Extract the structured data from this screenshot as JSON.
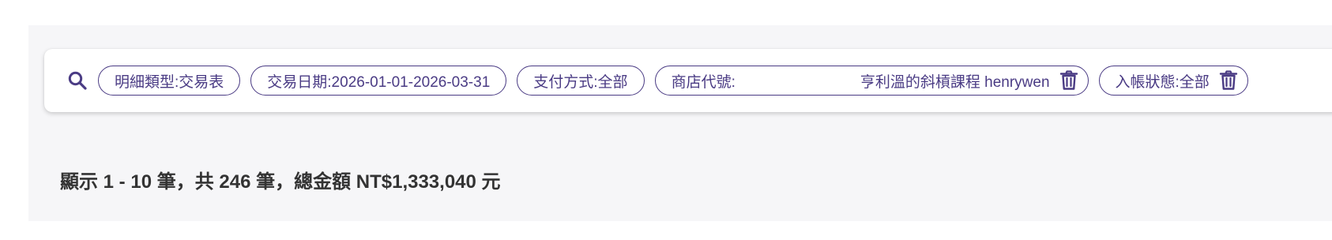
{
  "filters": {
    "search_icon": "search-icon",
    "chips": [
      {
        "text": "明細類型:交易表"
      },
      {
        "text": "交易日期:2026-01-01-2026-03-31"
      },
      {
        "text": "支付方式:全部"
      },
      {
        "label": "商店代號:",
        "value": "亨利溫的斜槓課程 henrywen",
        "delete_icon": "trash-icon"
      },
      {
        "text": "入帳狀態:全部",
        "delete_icon": "trash-icon"
      }
    ],
    "accent_color": "#4a3b84"
  },
  "summary": {
    "text": "顯示 1 - 10 筆，共 246 筆，總金額 NT$1,333,040 元"
  }
}
